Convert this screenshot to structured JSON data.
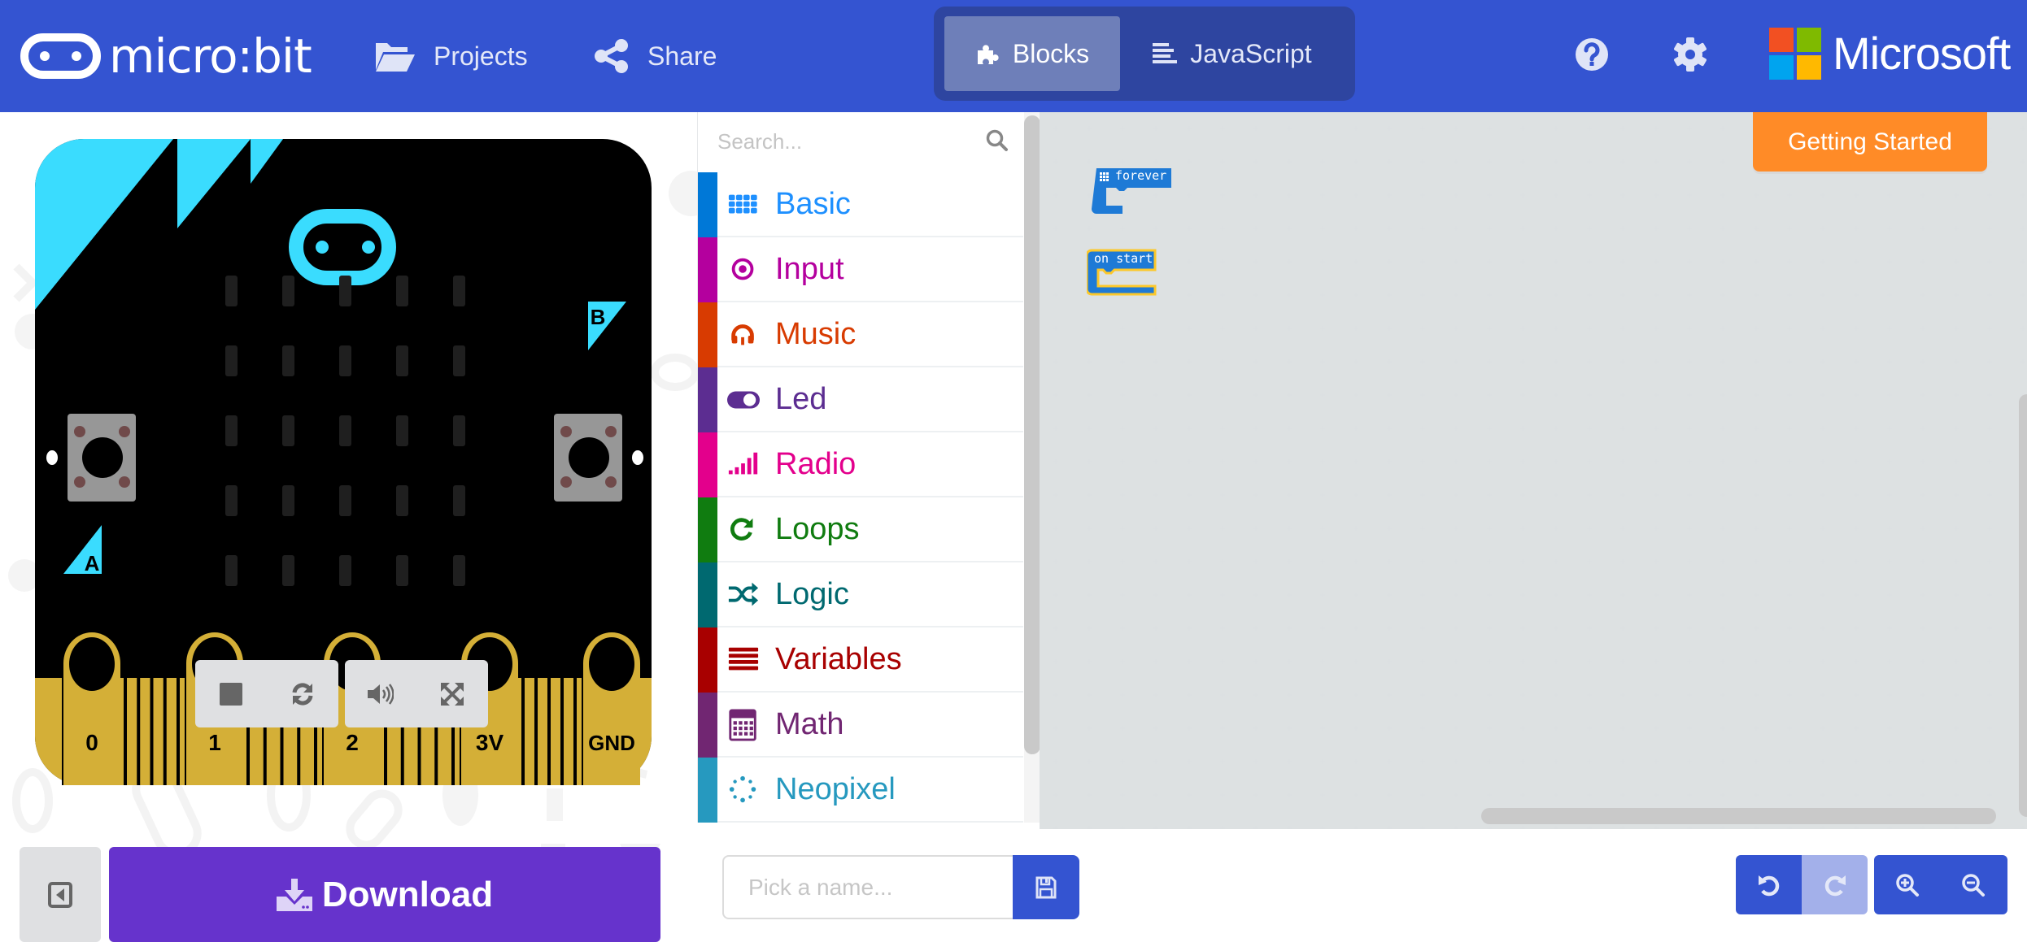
{
  "header": {
    "brand": "micro:bit",
    "nav": [
      {
        "label": "Projects",
        "icon": "folder-open-icon"
      },
      {
        "label": "Share",
        "icon": "share-icon"
      }
    ],
    "modes": [
      {
        "label": "Blocks",
        "icon": "puzzle-icon",
        "active": true
      },
      {
        "label": "JavaScript",
        "icon": "align-left-icon",
        "active": false
      }
    ],
    "help_icon": "question-circle-icon",
    "settings_icon": "gear-icon",
    "ms_brand": "Microsoft",
    "colors": {
      "bar": "#3454d1",
      "toggle_bg": "#2e45a0",
      "toggle_active": "#6e7fb9"
    }
  },
  "simulator": {
    "pins": [
      "0",
      "1",
      "2",
      "3V",
      "GND"
    ],
    "buttons": [
      "A",
      "B"
    ],
    "led_matrix": {
      "rows": 5,
      "cols": 5,
      "lit": []
    },
    "controls": [
      {
        "name": "stop",
        "icon": "stop-icon"
      },
      {
        "name": "restart",
        "icon": "refresh-icon"
      },
      {
        "name": "mute",
        "icon": "volume-icon"
      },
      {
        "name": "fullscreen",
        "icon": "expand-icon"
      }
    ],
    "colors": {
      "board": "#000000",
      "accent": "#3adcfe",
      "gold": "#d4af37",
      "button": "#979797"
    }
  },
  "toolbox": {
    "search_placeholder": "Search...",
    "categories": [
      {
        "label": "Basic",
        "color": "#1e90ff",
        "bar": "#0078d7",
        "icon": "grid-icon"
      },
      {
        "label": "Input",
        "color": "#b4009e",
        "bar": "#b4009e",
        "icon": "target-icon"
      },
      {
        "label": "Music",
        "color": "#d83b01",
        "bar": "#d83b01",
        "icon": "headphones-icon"
      },
      {
        "label": "Led",
        "color": "#5c2d91",
        "bar": "#5c2d91",
        "icon": "toggle-icon"
      },
      {
        "label": "Radio",
        "color": "#e3008c",
        "bar": "#e3008c",
        "icon": "signal-icon"
      },
      {
        "label": "Loops",
        "color": "#107c10",
        "bar": "#107c10",
        "icon": "redo-icon"
      },
      {
        "label": "Logic",
        "color": "#006970",
        "bar": "#006970",
        "icon": "shuffle-icon"
      },
      {
        "label": "Variables",
        "color": "#a80000",
        "bar": "#a80000",
        "icon": "list-icon"
      },
      {
        "label": "Math",
        "color": "#712672",
        "bar": "#712672",
        "icon": "calculator-icon"
      },
      {
        "label": "Neopixel",
        "color": "#2699bf",
        "bar": "#2699bf",
        "icon": "dots-circle-icon"
      }
    ]
  },
  "workspace": {
    "getting_started": "Getting Started",
    "blocks": [
      {
        "label": "forever",
        "color": "#1e7ad6"
      },
      {
        "label": "on start",
        "color": "#1e7ad6",
        "outline": "#fcc82b"
      }
    ]
  },
  "footer": {
    "download_label": "Download",
    "name_placeholder": "Pick a name...",
    "name_value": "",
    "download_color": "#6633cc"
  }
}
